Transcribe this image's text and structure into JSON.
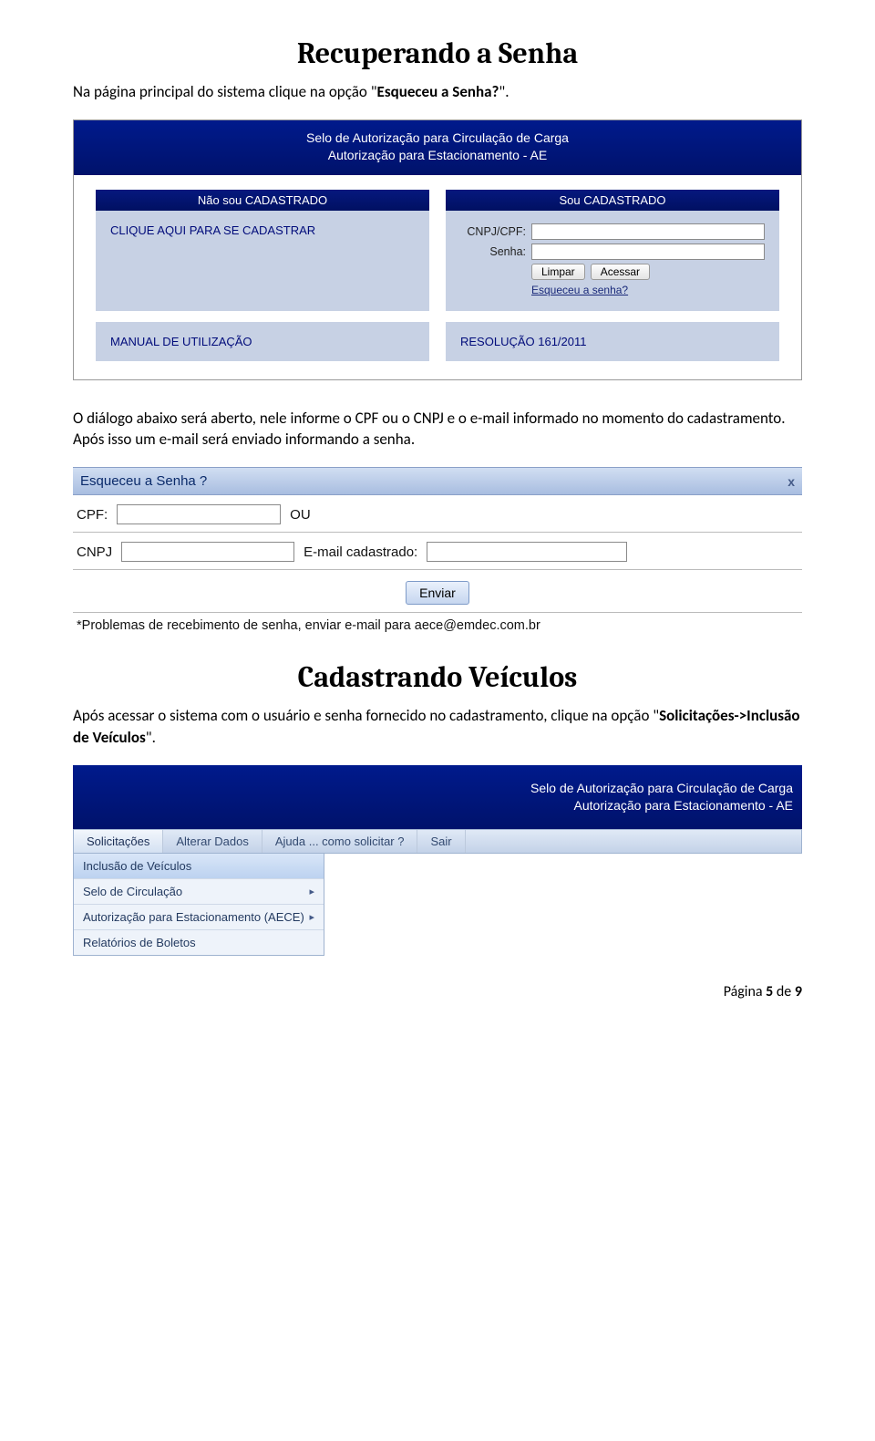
{
  "section1": {
    "title": "Recuperando a Senha",
    "intro_pre": "Na página principal do sistema clique na opção \"",
    "intro_bold": "Esqueceu a Senha?",
    "intro_post": "\".",
    "shot": {
      "banner_line1": "Selo de Autorização para Circulação de Carga",
      "banner_line2": "Autorização para Estacionamento - AE",
      "left_header": "Não sou CADASTRADO",
      "left_body": "CLIQUE AQUI PARA SE CADASTRAR",
      "right_header": "Sou CADASTRADO",
      "label_cnpjcpf": "CNPJ/CPF:",
      "label_senha": "Senha:",
      "btn_limpar": "Limpar",
      "btn_acessar": "Acessar",
      "forgot": "Esqueceu a senha?",
      "link_manual": "MANUAL DE UTILIZAÇÃO",
      "link_resolucao": "RESOLUÇÃO 161/2011"
    }
  },
  "section1b": {
    "para": "O diálogo abaixo será aberto, nele informe o CPF ou o CNPJ e o e-mail informado no momento do cadastramento. Após isso um e-mail será enviado informando a senha."
  },
  "dialog": {
    "title": "Esqueceu a Senha ?",
    "close": "x",
    "label_cpf": "CPF:",
    "ou": "OU",
    "label_cnpj": "CNPJ",
    "label_email": "E-mail cadastrado:",
    "btn_send": "Enviar",
    "note": "*Problemas de recebimento de senha, enviar e-mail para aece@emdec.com.br"
  },
  "section2": {
    "title": "Cadastrando Veículos",
    "intro_pre": "Após acessar o sistema com o usuário e senha fornecido no cadastramento, clique na opção \"",
    "intro_bold": "Solicitações->Inclusão de Veículos",
    "intro_post": "\".",
    "shot": {
      "banner_line1": "Selo de Autorização para Circulação de Carga",
      "banner_line2": "Autorização para Estacionamento - AE",
      "nav": [
        "Solicitações",
        "Alterar Dados",
        "Ajuda ... como solicitar ?",
        "Sair"
      ],
      "dropdown": [
        "Inclusão de Veículos",
        "Selo de Circulação",
        "Autorização para Estacionamento (AECE)",
        "Relatórios de Boletos"
      ]
    }
  },
  "footer": {
    "pre": "Página ",
    "num": "5",
    "mid": " de ",
    "total": "9"
  }
}
